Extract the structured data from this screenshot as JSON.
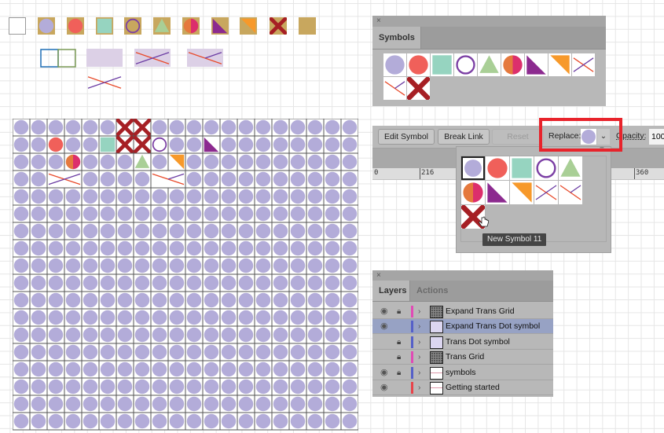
{
  "colors": {
    "lavender": "#b3acd9",
    "coral": "#f0605a",
    "mint": "#96d4c0",
    "purple_ring": "#7b3fa4",
    "sage": "#a9cf96",
    "half_left": "#e5793d",
    "half_right": "#dc2f6c",
    "violet_tri": "#8c2a8f",
    "orange_tri": "#f7992a",
    "cross_red": "#a61f24",
    "line_red": "#e84a2a",
    "line_purple": "#6b3ca3",
    "tile_bg": "#c8a75e",
    "highlight_box": "#e8232b"
  },
  "artboard_symbols": {
    "row1": [
      "empty-square",
      "lavender-circle",
      "coral-circle",
      "mint-square",
      "purple-ring",
      "sage-triangle",
      "half-circle",
      "violet-triangle",
      "orange-triangle",
      "red-cross",
      "gold-square"
    ],
    "row2": [
      "blue-green-squares",
      "lavender-rect",
      "lavender-rect-cross",
      "lavender-rect-half-cross"
    ],
    "row3": [
      "line-cross"
    ]
  },
  "symbols_panel": {
    "close_label": "×",
    "tab_label": "Symbols",
    "items": [
      "lavender-circle",
      "coral-circle",
      "mint-square",
      "purple-ring",
      "sage-triangle",
      "half-circle",
      "violet-triangle",
      "orange-triangle",
      "line-cross",
      "line-half-cross",
      "red-cross"
    ]
  },
  "control_bar": {
    "edit_symbol": "Edit Symbol",
    "break_link": "Break Link",
    "reset": "Reset",
    "replace_label": "Replace:",
    "opacity_label": "Opacity:",
    "opacity_value": "100",
    "ruler_marks": [
      "0",
      "216",
      "360"
    ]
  },
  "replace_dropdown": {
    "items": [
      "lavender-circle",
      "coral-circle",
      "mint-square",
      "purple-ring",
      "sage-triangle",
      "half-circle",
      "violet-triangle",
      "orange-triangle",
      "line-cross",
      "line-half-cross",
      "red-cross"
    ],
    "selected_index": 0,
    "tooltip": "New Symbol 11"
  },
  "layers_panel": {
    "close_label": "×",
    "tabs": [
      "Layers",
      "Actions"
    ],
    "rows": [
      {
        "name": "Expand Trans Grid",
        "visible": true,
        "locked": true,
        "color": "#e14ab5",
        "thumb": "grid",
        "selected": false
      },
      {
        "name": "Expand Trans Dot symbol",
        "visible": true,
        "locked": false,
        "color": "#5560c8",
        "thumb": "dots",
        "selected": true
      },
      {
        "name": "Trans Dot symbol",
        "visible": false,
        "locked": true,
        "color": "#5560c8",
        "thumb": "dots",
        "selected": false
      },
      {
        "name": "Trans Grid",
        "visible": false,
        "locked": true,
        "color": "#e14ab5",
        "thumb": "grid",
        "selected": false
      },
      {
        "name": "symbols",
        "visible": true,
        "locked": true,
        "color": "#5560c8",
        "thumb": "symbols",
        "selected": false
      },
      {
        "name": "Getting started",
        "visible": true,
        "locked": false,
        "color": "#e8434a",
        "thumb": "start",
        "selected": false
      }
    ]
  },
  "grid": {
    "columns": 20,
    "rows": 18,
    "default_symbol": "lavender-circle",
    "overrides": [
      {
        "r": 0,
        "c": 6,
        "s": "red-cross"
      },
      {
        "r": 0,
        "c": 7,
        "s": "red-cross"
      },
      {
        "r": 1,
        "c": 2,
        "s": "coral-circle"
      },
      {
        "r": 1,
        "c": 5,
        "s": "mint-square"
      },
      {
        "r": 1,
        "c": 6,
        "s": "red-cross"
      },
      {
        "r": 1,
        "c": 7,
        "s": "red-cross"
      },
      {
        "r": 1,
        "c": 8,
        "s": "purple-ring"
      },
      {
        "r": 1,
        "c": 11,
        "s": "violet-triangle"
      },
      {
        "r": 2,
        "c": 3,
        "s": "half-circle"
      },
      {
        "r": 2,
        "c": 7,
        "s": "sage-triangle"
      },
      {
        "r": 2,
        "c": 9,
        "s": "orange-triangle"
      }
    ],
    "wide_overrides": [
      {
        "r": 3,
        "c": 2,
        "span": 2,
        "s": "line-cross"
      },
      {
        "r": 3,
        "c": 8,
        "span": 2,
        "s": "line-half-cross"
      }
    ]
  }
}
